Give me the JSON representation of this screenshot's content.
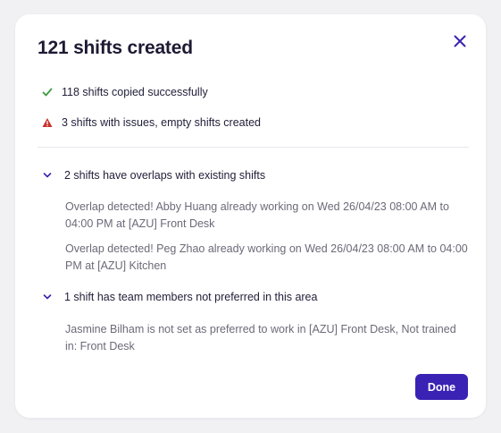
{
  "modal": {
    "title": "121 shifts created",
    "close_icon": "close-icon",
    "summary": [
      {
        "icon": "check-icon",
        "icon_color": "#3f9b3f",
        "text": "118 shifts copied successfully"
      },
      {
        "icon": "warning-icon",
        "icon_color": "#c8322c",
        "text": "3 shifts with issues, empty shifts created"
      }
    ],
    "sections": [
      {
        "icon": "chevron-down-icon",
        "title": "2 shifts have overlaps with existing shifts",
        "details": [
          "Overlap detected! Abby Huang already working on Wed 26/04/23 08:00 AM to 04:00 PM at [AZU] Front Desk",
          "Overlap detected! Peg Zhao already working on Wed 26/04/23 08:00 AM to 04:00 PM at [AZU] Kitchen"
        ]
      },
      {
        "icon": "chevron-down-icon",
        "title": "1 shift has team members not preferred in this area",
        "details": [
          "Jasmine Bilham is not set as preferred to work in [AZU] Front Desk, Not trained in: Front Desk"
        ]
      }
    ],
    "done_label": "Done"
  },
  "colors": {
    "accent": "#3a22b4",
    "success": "#3f9b3f",
    "warning": "#c8322c",
    "text_primary": "#1d1a33",
    "text_secondary": "#6b6a78",
    "backdrop": "#f1f1f4"
  }
}
